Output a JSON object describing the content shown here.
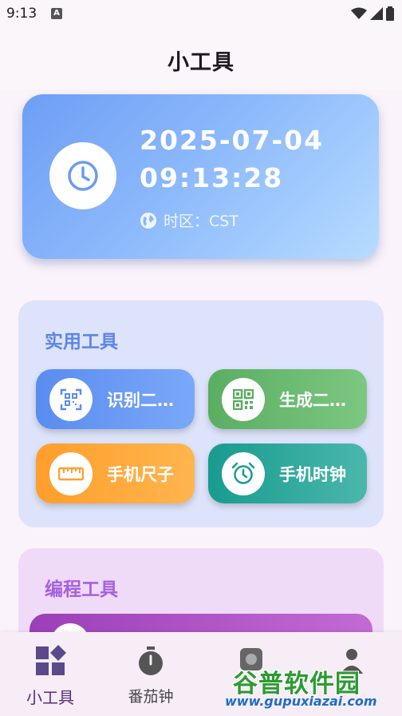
{
  "status_bar": {
    "time": "9:13",
    "notification_letter": "A"
  },
  "app_bar": {
    "title": "小工具"
  },
  "time_card": {
    "date": "2025-07-04",
    "time": "09:13:28",
    "timezone": "时区：CST"
  },
  "utility_section": {
    "title": "实用工具",
    "tools": [
      {
        "label": "识别二…",
        "icon": "qr-scan-icon"
      },
      {
        "label": "生成二…",
        "icon": "qr-code-icon"
      },
      {
        "label": "手机尺子",
        "icon": "ruler-icon"
      },
      {
        "label": "手机时钟",
        "icon": "alarm-clock-icon"
      }
    ]
  },
  "programming_section": {
    "title": "编程工具"
  },
  "bottom_nav": {
    "items": [
      {
        "label": "小工具",
        "icon": "widgets-icon",
        "active": true
      },
      {
        "label": "番茄钟",
        "icon": "timer-icon",
        "active": false
      },
      {
        "label": "",
        "icon": "tab-icon",
        "active": false
      },
      {
        "label": "",
        "icon": "profile-icon",
        "active": false
      }
    ]
  },
  "watermark": {
    "text": "谷普软件园",
    "url": "www.gupuxiazai.com"
  },
  "colors": {
    "utility_title": "#5b86e3",
    "programming_title": "#a560df",
    "scan_button": "#5a8cf0",
    "generate_button": "#5aae62",
    "ruler_button": "#ff9e2c",
    "clock_button": "#189b8f",
    "nav_active": "#5a2a80"
  }
}
